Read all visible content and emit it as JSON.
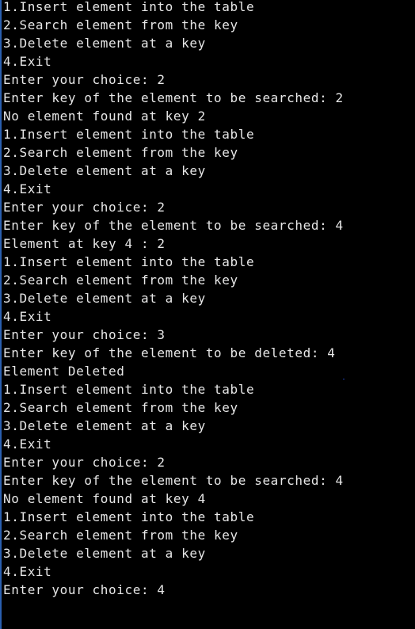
{
  "console": {
    "lines": [
      "1.Insert element into the table",
      "2.Search element from the key",
      "3.Delete element at a key",
      "4.Exit",
      "Enter your choice: 2",
      "Enter key of the element to be searched: 2",
      "No element found at key 2",
      "1.Insert element into the table",
      "2.Search element from the key",
      "3.Delete element at a key",
      "4.Exit",
      "Enter your choice: 2",
      "Enter key of the element to be searched: 4",
      "Element at key 4 : 2",
      "1.Insert element into the table",
      "2.Search element from the key",
      "3.Delete element at a key",
      "4.Exit",
      "Enter your choice: 3",
      "Enter key of the element to be deleted: 4",
      "Element Deleted",
      "1.Insert element into the table",
      "2.Search element from the key",
      "3.Delete element at a key",
      "4.Exit",
      "Enter your choice: 2",
      "Enter key of the element to be searched: 4",
      "No element found at key 4",
      "1.Insert element into the table",
      "2.Search element from the key",
      "3.Delete element at a key",
      "4.Exit",
      "Enter your choice: 4"
    ]
  },
  "colors": {
    "background": "#000000",
    "text": "#e6e6e6",
    "window_edge": "#2a5fb0"
  }
}
